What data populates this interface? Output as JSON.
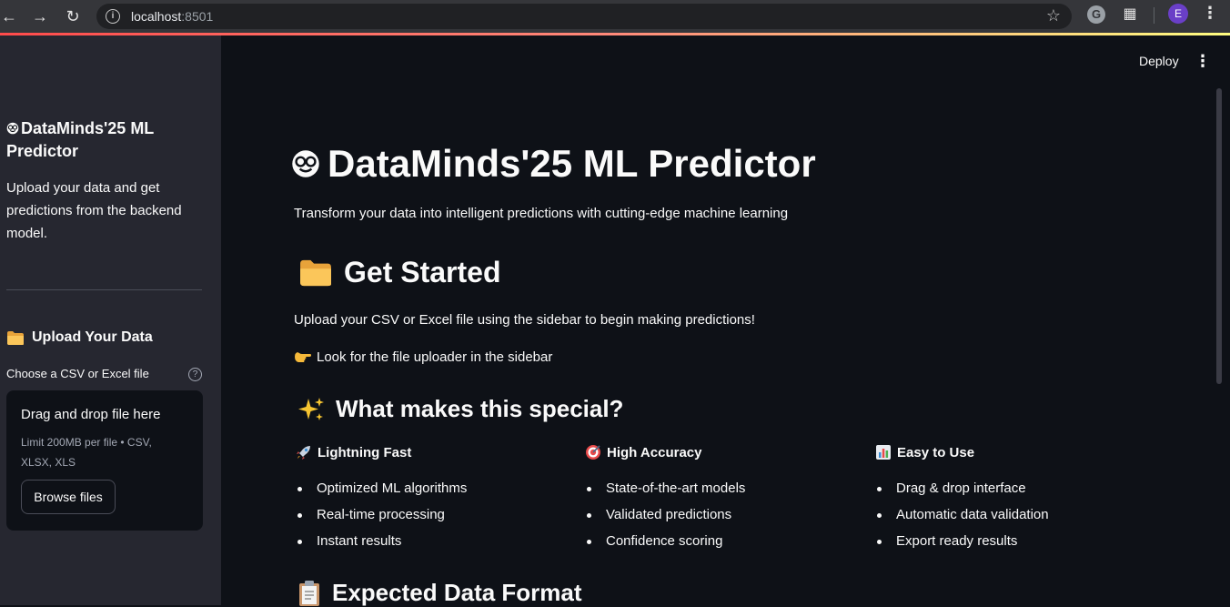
{
  "browser": {
    "url_host": "localhost",
    "url_port": ":8501",
    "profile_initial": "E",
    "g_label": "G"
  },
  "sidebar": {
    "title": "DataMinds'25 ML Predictor",
    "description": "Upload your data and get predictions from the backend model.",
    "upload_heading": "Upload Your Data",
    "file_label": "Choose a CSV or Excel file",
    "dropzone_title": "Drag and drop file here",
    "dropzone_limit": "Limit 200MB per file • CSV, XLSX, XLS",
    "browse_button": "Browse files"
  },
  "header": {
    "deploy_label": "Deploy"
  },
  "main": {
    "title": "DataMinds'25 ML Predictor",
    "tagline": "Transform your data into intelligent predictions with cutting-edge machine learning",
    "get_started_heading": "Get Started",
    "upload_instruction": "Upload your CSV or Excel file using the sidebar to begin making predictions!",
    "look_hint": "Look for the file uploader in the sidebar",
    "special_heading": "What makes this special?",
    "features": [
      {
        "icon": "rocket-icon",
        "emoji": "🚀",
        "title": "Lightning Fast",
        "items": [
          "Optimized ML algorithms",
          "Real-time processing",
          "Instant results"
        ]
      },
      {
        "icon": "target-icon",
        "emoji": "🎯",
        "title": "High Accuracy",
        "items": [
          "State-of-the-art models",
          "Validated predictions",
          "Confidence scoring"
        ]
      },
      {
        "icon": "bar-chart-icon",
        "emoji": "📊",
        "title": "Easy to Use",
        "items": [
          "Drag & drop interface",
          "Automatic data validation",
          "Export ready results"
        ]
      }
    ],
    "format_heading": "Expected Data Format"
  }
}
